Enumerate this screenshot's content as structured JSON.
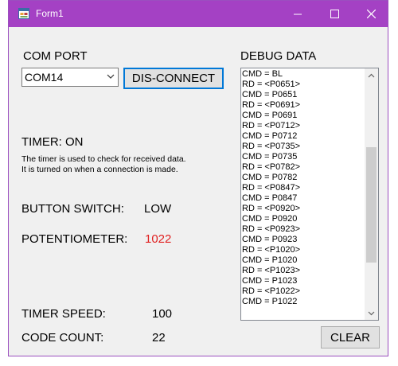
{
  "window": {
    "title": "Form1"
  },
  "com_port": {
    "label": "COM PORT",
    "selected": "COM14",
    "connect_button": "DIS-CONNECT"
  },
  "timer": {
    "status": "TIMER: ON",
    "desc_line1": "The timer is used to check for received data.",
    "desc_line2": "It is turned on when a connection is made."
  },
  "button_switch": {
    "label": "BUTTON SWITCH:",
    "value": "LOW"
  },
  "potentiometer": {
    "label": "POTENTIOMETER:",
    "value": "1022",
    "value_color": "#e02020"
  },
  "timer_speed": {
    "label": "TIMER SPEED:",
    "value": "100"
  },
  "code_count": {
    "label": "CODE COUNT:",
    "value": "22"
  },
  "debug": {
    "label": "DEBUG DATA",
    "clear_button": "CLEAR",
    "scroll_position": 0.6,
    "lines": [
      "CMD = BL",
      "RD = <P0651>",
      "CMD = P0651",
      "RD = <P0691>",
      "CMD = P0691",
      "RD = <P0712>",
      "CMD = P0712",
      "RD = <P0735>",
      "CMD = P0735",
      "RD = <P0782>",
      "CMD = P0782",
      "RD = <P0847>",
      "CMD = P0847",
      "RD = <P0920>",
      "CMD = P0920",
      "RD = <P0923>",
      "CMD = P0923",
      "RD = <P1020>",
      "CMD = P1020",
      "RD = <P1023>",
      "CMD = P1023",
      "RD = <P1022>",
      "CMD = P1022"
    ]
  },
  "colors": {
    "titlebar": "#a441c4",
    "accent": "#0078d7"
  }
}
